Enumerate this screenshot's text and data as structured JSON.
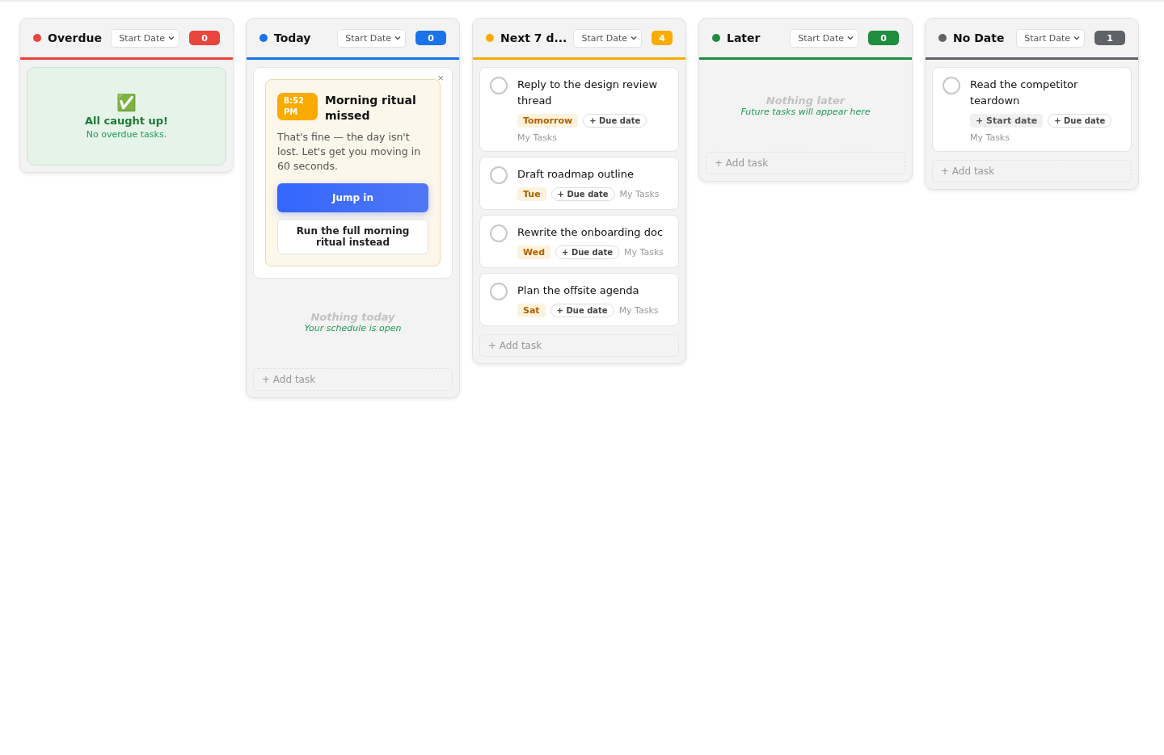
{
  "columns": [
    {
      "title": "Overdue",
      "color": "#e8453c",
      "sort": "Start Date",
      "count": "0",
      "empty": {
        "kind": "success",
        "emoji": "✅",
        "title": "All caught up!",
        "text": "No overdue tasks."
      }
    },
    {
      "title": "Today",
      "color": "#1a73e8",
      "sort": "Start Date",
      "count": "0",
      "nudge": {
        "time": "8:52 PM",
        "close": "×",
        "title": "Morning ritual missed",
        "text": "That's fine — the day isn't lost. Let's get you moving in 60 seconds.",
        "primary": "Jump in",
        "secondary": "Run the full morning ritual instead"
      },
      "empty": {
        "kind": "note",
        "title": "Nothing today",
        "text": "Your schedule is open"
      },
      "add": "+ Add task"
    },
    {
      "title": "Next 7 d...",
      "color": "#f9ab00",
      "sort": "Start Date",
      "count": "4",
      "tasks": [
        {
          "title": "Reply to the design review thread",
          "done": false,
          "start": {
            "kind": "date",
            "label": "Tomorrow"
          },
          "due": "+ Due date",
          "list": "My Tasks"
        },
        {
          "title": "Draft roadmap outline",
          "done": false,
          "start": {
            "kind": "date",
            "label": "Tue"
          },
          "due": "+ Due date",
          "list": "My Tasks"
        },
        {
          "title": "Rewrite the onboarding doc",
          "done": false,
          "start": {
            "kind": "date",
            "label": "Wed"
          },
          "due": "+ Due date",
          "list": "My Tasks"
        },
        {
          "title": "Plan the offsite agenda",
          "done": false,
          "start": {
            "kind": "date",
            "label": "Sat"
          },
          "due": "+ Due date",
          "list": "My Tasks"
        }
      ],
      "add": "+ Add task"
    },
    {
      "title": "Later",
      "color": "#1e8e3e",
      "sort": "Start Date",
      "count": "0",
      "empty": {
        "kind": "note",
        "title": "Nothing later",
        "text": "Future tasks will appear here"
      },
      "add": "+ Add task"
    },
    {
      "title": "No Date",
      "color": "#5f6368",
      "sort": "Start Date",
      "count": "1",
      "tasks": [
        {
          "title": "Read the competitor teardown",
          "done": false,
          "start": {
            "kind": "add",
            "label": "+ Start date"
          },
          "due": "+ Due date",
          "list": "My Tasks"
        }
      ],
      "add": "+ Add task"
    }
  ]
}
